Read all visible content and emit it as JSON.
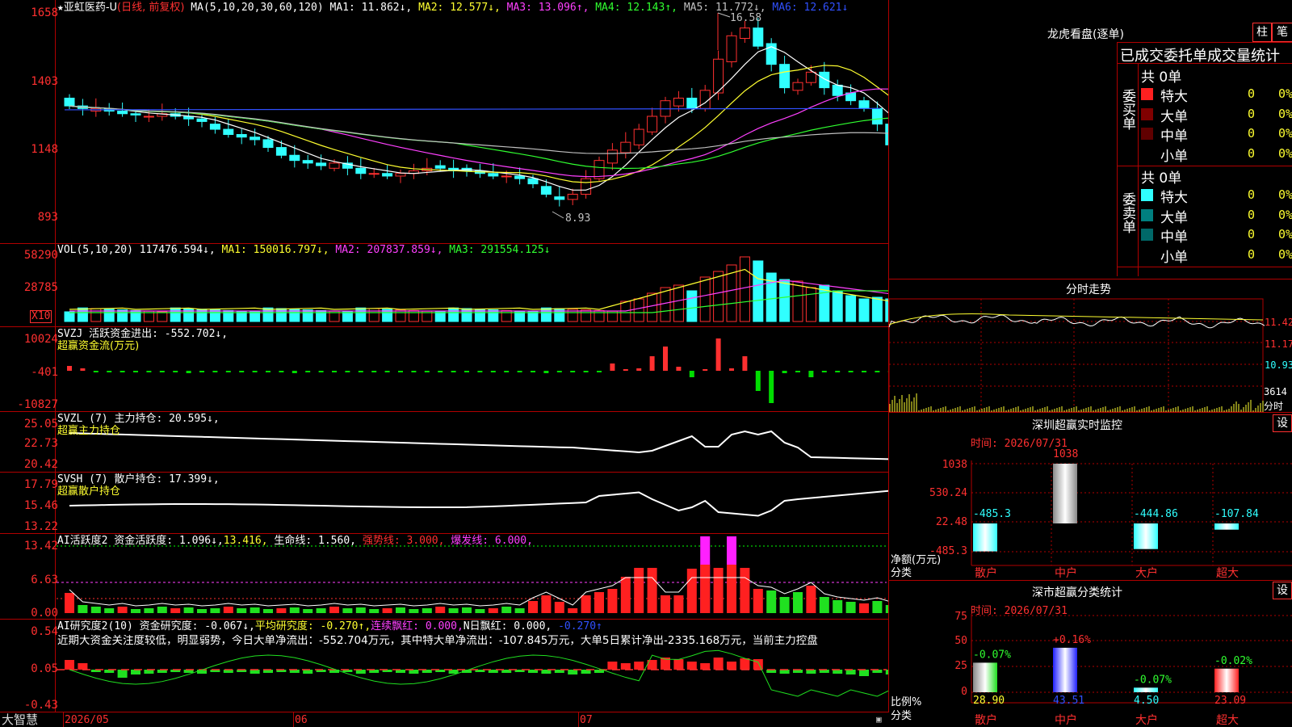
{
  "colors": {
    "up": "#ff3030",
    "down": "#30ffff",
    "grid": "#b00000",
    "ma1": "#ffffff",
    "ma2": "#ffff30",
    "ma3": "#ff40ff",
    "ma4": "#30ff30",
    "ma5": "#c0c0c0",
    "ma6": "#3050ff"
  },
  "header": {
    "star": "★",
    "stock_name": "亚虹医药-U",
    "period": "(日线, 前复权)",
    "ma_label": "MA(5,10,20,30,60,120)",
    "ma1": "MA1: 11.862↓,",
    "ma2": "MA2: 12.577↓,",
    "ma3": "MA3: 13.096↑,",
    "ma4": "MA4: 12.143↑,",
    "ma5": "MA5: 11.772↓,",
    "ma6": "MA6: 12.621↓"
  },
  "price_axis": [
    "1658",
    "1403",
    "1148",
    "893"
  ],
  "price_marks": {
    "high": "16.58",
    "low": "8.93"
  },
  "vol_panel": {
    "label": "VOL(5,10,20)",
    "value": "117476.594↓,",
    "ma1": "MA1: 150016.797↓,",
    "ma2": "MA2: 207837.859↓,",
    "ma3": "MA3: 291554.125↓",
    "axis": [
      "58290",
      "28785"
    ],
    "unit": "X10"
  },
  "svzj_panel": {
    "label": "SVZJ  活跃资金进出: -552.702↓,",
    "sublabel": "超赢资金流(万元)",
    "axis": [
      "10024",
      "-401",
      "-10827"
    ]
  },
  "svzl_panel": {
    "label": "SVZL (7) 主力持仓: 20.595↓,",
    "sublabel": "超赢主力持仓",
    "axis": [
      "25.05",
      "22.73",
      "20.42"
    ]
  },
  "svsh_panel": {
    "label": "SVSH (7) 散户持仓: 17.399↓,",
    "sublabel": "超赢散户持仓",
    "axis": [
      "17.79",
      "15.46",
      "13.22"
    ]
  },
  "ai1_panel": {
    "label": "AI活跃度2 资金活跃度: 1.096↓,",
    "v2": "13.416,",
    "life": "生命线: 1.560,",
    "strong": "强势线: 3.000,",
    "burst": "爆发线: 6.000,",
    "axis": [
      "13.42",
      "6.63",
      "0.00"
    ]
  },
  "ai2_panel": {
    "label": "AI研究度2(10) 资金研究度: -0.067↓,",
    "avg": "平均研究度: -0.270↑,",
    "cont": "连续飘红: 0.000,",
    "nred": "N日飘红: 0.000,",
    "last": "-0.270↑",
    "comment": "近期大资金关注度较低，明显弱势，今日大单净流出：-552.704万元，其中特大单净流出：-107.845万元，大单5日累计净出-2335.168万元，当前主力控盘",
    "axis": [
      "0.54",
      "0.05",
      "-0.43"
    ]
  },
  "bottom_bar": {
    "logo": "大智慧",
    "date1": "2026/05",
    "date2": "06",
    "date3": "07"
  },
  "right_top": {
    "title": "龙虎看盘(逐单)",
    "btn1": "柱",
    "btn2": "笔",
    "subtitle": "已成交委托单成交量统计",
    "buy_label": "委买单",
    "sell_label": "委卖单",
    "buy_total": "共 0单",
    "sell_total": "共 0单",
    "buy_rows": [
      {
        "name": "特大",
        "count": "0",
        "pct": "0%",
        "color": "#ff2020"
      },
      {
        "name": "大单",
        "count": "0",
        "pct": "0%",
        "color": "#800000"
      },
      {
        "name": "中单",
        "count": "0",
        "pct": "0%",
        "color": "#600000"
      },
      {
        "name": "小单",
        "count": "0",
        "pct": "0%",
        "color": ""
      }
    ],
    "sell_rows": [
      {
        "name": "特大",
        "count": "0",
        "pct": "0%",
        "color": "#30ffff"
      },
      {
        "name": "大单",
        "count": "0",
        "pct": "0%",
        "color": "#008080"
      },
      {
        "name": "中单",
        "count": "0",
        "pct": "0%",
        "color": "#006868"
      },
      {
        "name": "小单",
        "count": "0",
        "pct": "0%",
        "color": ""
      }
    ]
  },
  "intraday": {
    "title": "分时走势",
    "axis": [
      "11.42",
      "11.17",
      "10.93"
    ],
    "vol_value": "3614",
    "vol_unit": "分时"
  },
  "monitor": {
    "title": "深圳超赢实时监控",
    "set": "设",
    "time": "时间: 2026/07/31",
    "axis": [
      "1038",
      "530.24",
      "22.48",
      "-485.3"
    ],
    "ylabel": "净额(万元)",
    "xlabel": "分类",
    "categories": [
      "散户",
      "中户",
      "大户",
      "超大"
    ],
    "values": [
      "-485.3",
      "1038",
      "-444.86",
      "-107.84"
    ]
  },
  "classify": {
    "title": "深市超赢分类统计",
    "set": "设",
    "time": "时间: 2026/07/31",
    "axis": [
      "75",
      "50",
      "25",
      "0"
    ],
    "ylabel": "比例%",
    "xlabel": "分类",
    "categories": [
      "散户",
      "中户",
      "大户",
      "超大"
    ],
    "changes": [
      "-0.07%",
      "+0.16%",
      "-0.07%",
      "-0.02%"
    ],
    "values": [
      "28.90",
      "43.51",
      "4.50",
      "23.09"
    ]
  }
}
